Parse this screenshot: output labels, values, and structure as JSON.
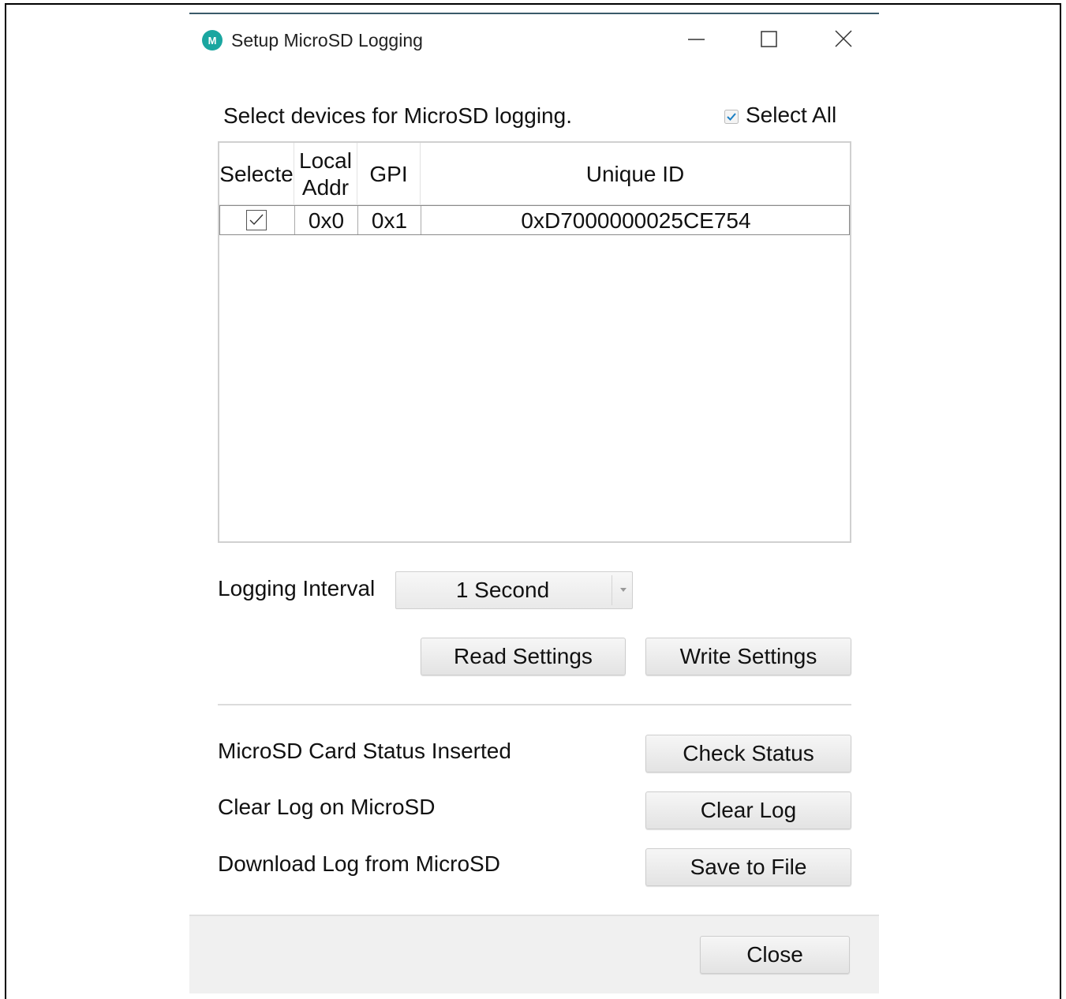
{
  "window": {
    "title": "Setup MicroSD Logging",
    "icon": "maxim-logo-icon",
    "accent_color": "#1aa6a0"
  },
  "instructions": "Select devices for MicroSD logging.",
  "select_all": {
    "label": "Select All",
    "checked": true
  },
  "device_table": {
    "columns": [
      "Selecte",
      "Local Addr",
      "GPI",
      "Unique ID"
    ],
    "rows": [
      {
        "selected": true,
        "local_addr": "0x0",
        "gpi": "0x1",
        "unique_id": "0xD7000000025CE754"
      }
    ]
  },
  "logging_interval": {
    "label": "Logging Interval",
    "value": "1 Second"
  },
  "buttons": {
    "read_settings": "Read Settings",
    "write_settings": "Write Settings",
    "check_status": "Check Status",
    "clear_log": "Clear Log",
    "save_to_file": "Save to File",
    "close": "Close"
  },
  "status": {
    "card_status_label": "MicroSD Card Status Inserted",
    "clear_log_label": "Clear Log on MicroSD",
    "download_log_label": "Download Log from MicroSD"
  }
}
